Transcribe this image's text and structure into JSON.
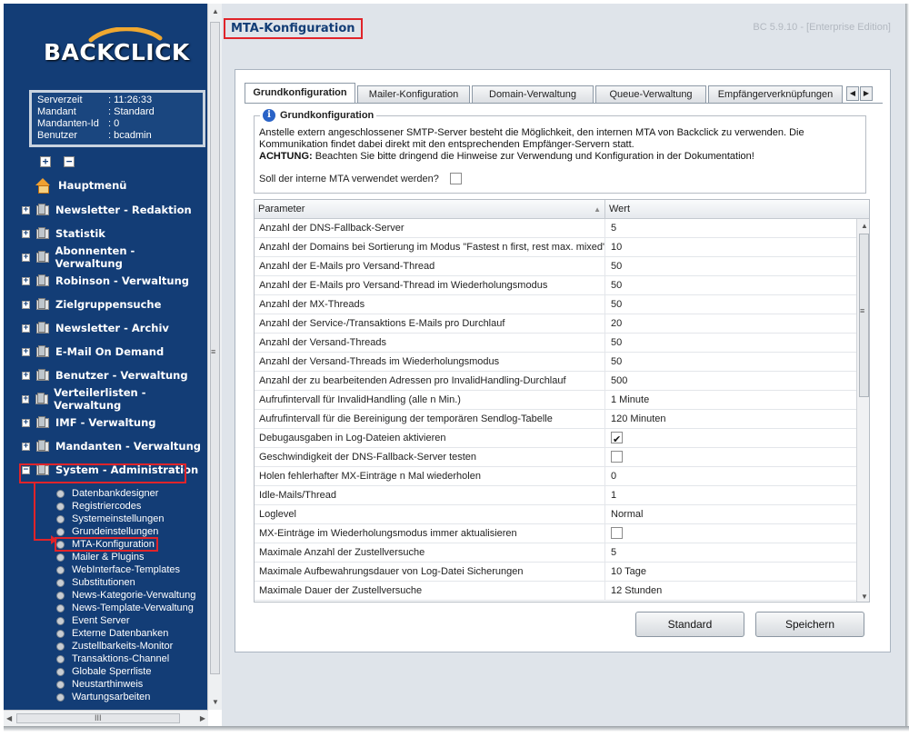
{
  "app": {
    "logo_text": "BACKCLICK",
    "version": "BC 5.9.10 - [Enterprise Edition]",
    "page_title": "MTA-Konfiguration"
  },
  "server_info": [
    {
      "label": "Serverzeit",
      "value": ": 11:26:33"
    },
    {
      "label": "Mandant",
      "value": ": Standard"
    },
    {
      "label": "Mandanten-Id",
      "value": ": 0"
    },
    {
      "label": "Benutzer",
      "value": ": bcadmin"
    }
  ],
  "nav": {
    "home": "Hauptmenü",
    "sections": [
      "Newsletter - Redaktion",
      "Statistik",
      "Abonnenten - Verwaltung",
      "Robinson - Verwaltung",
      "Zielgruppensuche",
      "Newsletter - Archiv",
      "E-Mail On Demand",
      "Benutzer - Verwaltung",
      "Verteilerlisten - Verwaltung",
      "IMF - Verwaltung",
      "Mandanten - Verwaltung",
      "System - Administration"
    ],
    "sub_items": [
      "Datenbankdesigner",
      "Registriercodes",
      "Systemeinstellungen",
      "Grundeinstellungen",
      "MTA-Konfiguration",
      "Mailer & Plugins",
      "WebInterface-Templates",
      "Substitutionen",
      "News-Kategorie-Verwaltung",
      "News-Template-Verwaltung",
      "Event Server",
      "Externe Datenbanken",
      "Zustellbarkeits-Monitor",
      "Transaktions-Channel",
      "Globale Sperrliste",
      "Neustarthinweis",
      "Wartungsarbeiten"
    ],
    "active_sub": "MTA-Konfiguration"
  },
  "tabs": [
    "Grundkonfiguration",
    "Mailer-Konfiguration",
    "Domain-Verwaltung",
    "Queue-Verwaltung",
    "Empfängerverknüpfungen"
  ],
  "info": {
    "legend": "Grundkonfiguration",
    "text": "Anstelle extern angeschlossener SMTP-Server besteht die Möglichkeit, den internen MTA von Backclick zu verwenden. Die Kommunikation findet dabei direkt mit den entsprechenden Empfänger-Servern statt.",
    "warning_label": "ACHTUNG:",
    "warning_text": " Beachten Sie bitte dringend die Hinweise zur Verwendung und Konfiguration in der Dokumentation!",
    "question": "Soll der interne MTA verwendet werden?",
    "use_internal_mta": false
  },
  "grid": {
    "col_param": "Parameter",
    "col_value": "Wert",
    "rows": [
      {
        "param": "Anzahl der DNS-Fallback-Server",
        "value": "5"
      },
      {
        "param": "Anzahl der Domains bei Sortierung im Modus \"Fastest n first, rest max. mixed\"",
        "value": "10"
      },
      {
        "param": "Anzahl der E-Mails pro Versand-Thread",
        "value": "50"
      },
      {
        "param": "Anzahl der E-Mails pro Versand-Thread im Wiederholungsmodus",
        "value": "50"
      },
      {
        "param": "Anzahl der MX-Threads",
        "value": "50"
      },
      {
        "param": "Anzahl der Service-/Transaktions E-Mails pro Durchlauf",
        "value": "20"
      },
      {
        "param": "Anzahl der Versand-Threads",
        "value": "50"
      },
      {
        "param": "Anzahl der Versand-Threads im Wiederholungsmodus",
        "value": "50"
      },
      {
        "param": "Anzahl der zu bearbeitenden Adressen pro InvalidHandling-Durchlauf",
        "value": "500"
      },
      {
        "param": "Aufrufintervall für InvalidHandling (alle n Min.)",
        "value": "1 Minute"
      },
      {
        "param": "Aufrufintervall für die Bereinigung der temporären Sendlog-Tabelle",
        "value": "120 Minuten"
      },
      {
        "param": "Debugausgaben in Log-Dateien aktivieren",
        "checkbox": true,
        "checked": true
      },
      {
        "param": "Geschwindigkeit der DNS-Fallback-Server testen",
        "checkbox": true,
        "checked": false
      },
      {
        "param": "Holen fehlerhafter MX-Einträge n Mal wiederholen",
        "value": "0"
      },
      {
        "param": "Idle-Mails/Thread",
        "value": "1"
      },
      {
        "param": "Loglevel",
        "value": "Normal"
      },
      {
        "param": "MX-Einträge im Wiederholungsmodus immer aktualisieren",
        "checkbox": true,
        "checked": false
      },
      {
        "param": "Maximale Anzahl der Zustellversuche",
        "value": "5"
      },
      {
        "param": "Maximale Aufbewahrungsdauer von Log-Datei Sicherungen",
        "value": "10 Tage"
      },
      {
        "param": "Maximale Dauer der Zustellversuche",
        "value": "12 Stunden"
      }
    ]
  },
  "buttons": {
    "standard": "Standard",
    "save": "Speichern"
  },
  "colors": {
    "sidebar_bg": "#133d76",
    "highlight": "#e0242a",
    "main_bg": "#dfe4ea"
  }
}
